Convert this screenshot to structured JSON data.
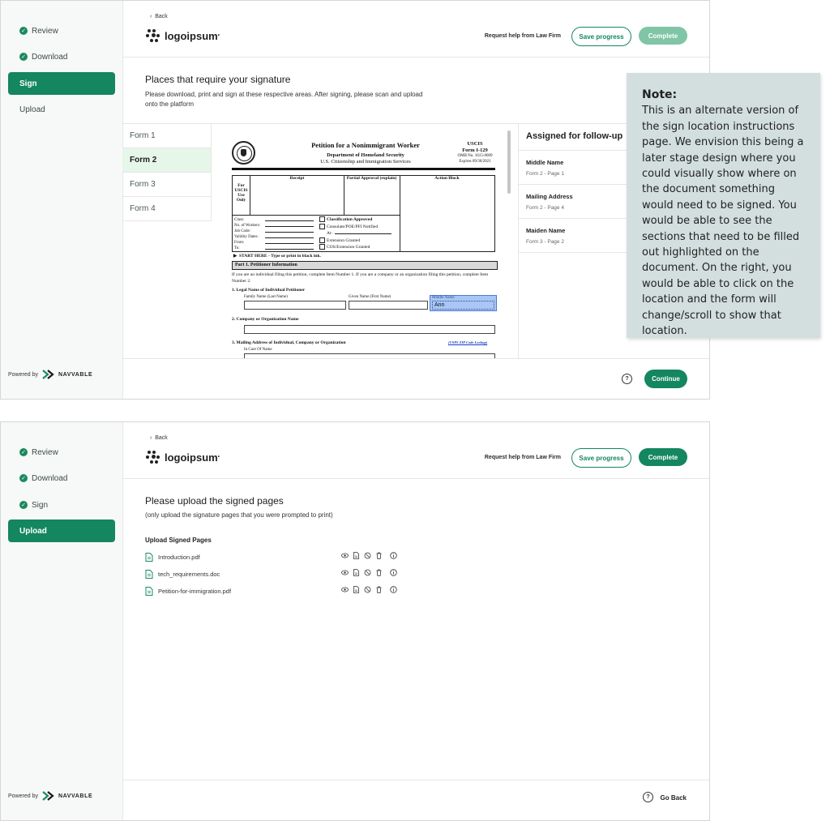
{
  "screen1": {
    "steps": [
      {
        "label": "Review",
        "state": "done"
      },
      {
        "label": "Download",
        "state": "done"
      },
      {
        "label": "Sign",
        "state": "active"
      },
      {
        "label": "Upload",
        "state": "pending"
      }
    ],
    "powered_by": "Powered by",
    "brand": "NAVVABLE",
    "back": "Back",
    "logo_text": "logoipsum",
    "help_link": "Request help from Law Firm",
    "save_progress": "Save progress",
    "complete": "Complete",
    "title": "Places that require your signature",
    "description": "Please download, print and sign at these respective areas. After signing, please scan and upload onto the platform",
    "forms": [
      "Form 1",
      "Form 2",
      "Form 3",
      "Form 4"
    ],
    "selected_form": "Form 2",
    "document": {
      "heading": "Petition for a Nonimmigrant Worker",
      "dept1": "Department of Homeland Security",
      "dept2": "U.S. Citizenship and Immigration Services",
      "agency": "USCIS",
      "form_no": "Form I-129",
      "omb": "OMB No. 1615-0009",
      "expires": "Expires 09/30/2021",
      "receipt": "Receipt",
      "partial": "Partial Approval (explain)",
      "action": "Action Block",
      "for_uscis": "For USCIS Use Only",
      "class_fields": [
        "Class:",
        "No. of Workers:",
        "Job Code:",
        "Validity Dates:",
        "From:",
        "To:"
      ],
      "checks": [
        "Classification Approved",
        "Consulate/POE/PFI Notified",
        "At:",
        "Extension Granted",
        "COS/Extension Granted"
      ],
      "start_here": "START HERE - Type or print in black ink.",
      "part1": "Part 1.   Petitioner Information",
      "instructions": "If you are an individual filing this petition, complete Item Number 1.  If you are a company or an organization filing this petition, complete Item Number 2.",
      "item1": "1.    Legal Name of Individual Petitioner",
      "family_name": "Family Name (Last Name)",
      "given_name": "Given Name (First Name)",
      "middle_name": "Middle Name",
      "middle_value": "Ann",
      "item2": "2.    Company or Organization Name",
      "item3": "3.    Mailing Address of Individual, Company or Organization",
      "usps": "(USPS ZIP Code Lookup)",
      "care_of": "In Care Of Name"
    },
    "follow_up": {
      "title": "Assigned for follow-up",
      "items": [
        {
          "name": "Middle Name",
          "location": "Form 2  - Page 1"
        },
        {
          "name": "Mailing Address",
          "location": "Form 2  - Page 4"
        },
        {
          "name": "Maiden Name",
          "location": "Form 3  - Page 2"
        }
      ]
    },
    "help_icon": "?",
    "continue": "Continue"
  },
  "note": {
    "title": "Note:",
    "body": "This is an alternate version of the sign location instructions page. We envision this being a later stage design where you could visually show where on the document something would need to be signed. You would be able to see the sections that need to be filled out highlighted on the document. On the right, you would be able to click on the location and the form will change/scroll to show that location."
  },
  "screen2": {
    "steps": [
      {
        "label": "Review",
        "state": "done"
      },
      {
        "label": "Download",
        "state": "done"
      },
      {
        "label": "Sign",
        "state": "done"
      },
      {
        "label": "Upload",
        "state": "active"
      }
    ],
    "powered_by": "Powered by",
    "brand": "NAVVABLE",
    "back": "Back",
    "logo_text": "logoipsum",
    "help_link": "Request help from Law Firm",
    "save_progress": "Save progress",
    "complete": "Complete",
    "title": "Please upload the signed pages",
    "subtitle": "(only upload the signature pages that you were prompted to print)",
    "upload_heading": "Upload Signed Pages",
    "files": [
      "Introduction.pdf",
      "tech_requirements.doc",
      "Petition-for-immigration.pdf"
    ],
    "help_icon": "?",
    "go_back": "Go Back"
  },
  "colors": {
    "brand_green": "#148660",
    "complete_disabled": "#7fc5a6",
    "selected_form_bg": "#e6f6e9",
    "note_bg": "#d3dfde"
  }
}
